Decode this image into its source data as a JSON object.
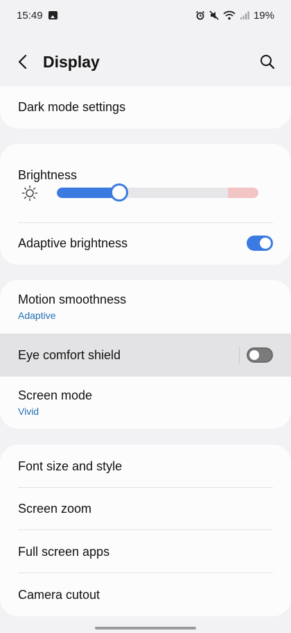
{
  "status_bar": {
    "time": "15:49",
    "battery": "19%",
    "icons": [
      "gallery-icon",
      "alarm-icon",
      "mute-icon",
      "wifi-icon",
      "signal-icon"
    ]
  },
  "header": {
    "title": "Display",
    "back_icon": "chevron-left-icon",
    "search_icon": "search-icon"
  },
  "sections": {
    "dark_mode": {
      "label": "Dark mode settings"
    },
    "brightness": {
      "label": "Brightness",
      "icon": "sun-icon",
      "level_fraction": 0.31,
      "high_zone_fraction": 0.15,
      "adaptive_label": "Adaptive brightness",
      "adaptive_on": true
    },
    "motion": {
      "label": "Motion smoothness",
      "value": "Adaptive"
    },
    "eye_comfort": {
      "label": "Eye comfort shield",
      "on": false
    },
    "screen_mode": {
      "label": "Screen mode",
      "value": "Vivid"
    },
    "more": [
      {
        "label": "Font size and style"
      },
      {
        "label": "Screen zoom"
      },
      {
        "label": "Full screen apps"
      },
      {
        "label": "Camera cutout"
      }
    ]
  },
  "colors": {
    "accent": "#3b7ae0",
    "link": "#1f6fb2",
    "highlight_row": "#e3e3e5"
  }
}
